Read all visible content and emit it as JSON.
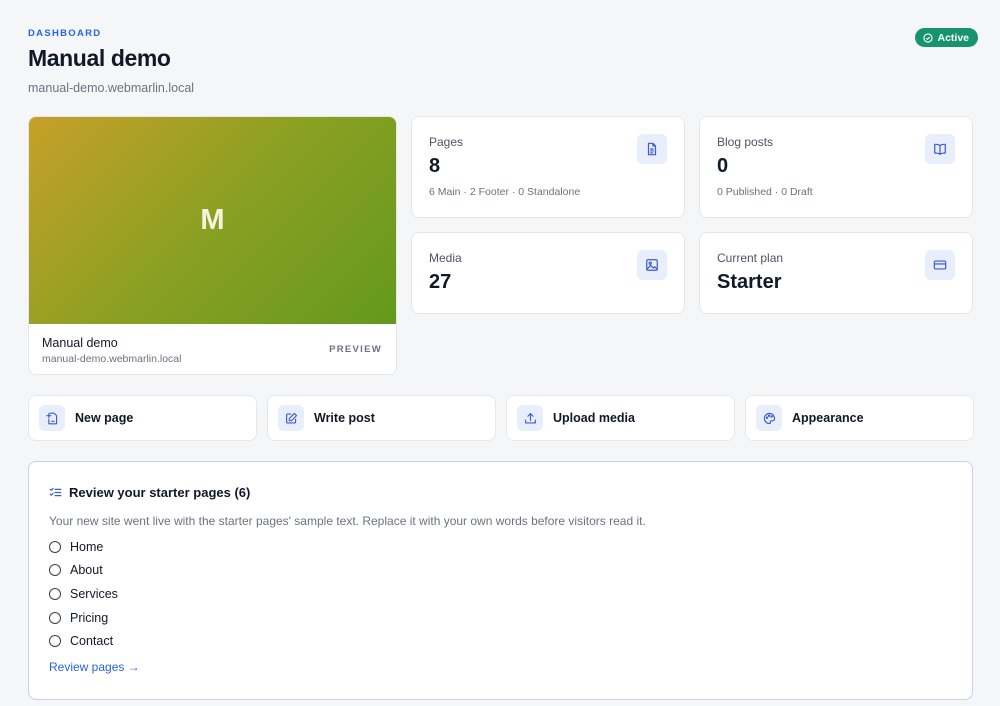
{
  "header": {
    "eyebrow": "DASHBOARD",
    "title": "Manual demo",
    "domain": "manual-demo.webmarlin.local",
    "status": "Active",
    "status_color": "#16946b"
  },
  "preview": {
    "initial": "M",
    "name": "Manual demo",
    "domain": "manual-demo.webmarlin.local",
    "link_label": "PREVIEW",
    "gradient_colors": [
      "#c7a029",
      "#63991d"
    ]
  },
  "stats": {
    "pages": {
      "label": "Pages",
      "value": "8",
      "sub": "6 Main · 2 Footer · 0 Standalone",
      "icon": "document-icon"
    },
    "blog": {
      "label": "Blog posts",
      "value": "0",
      "sub": "0 Published · 0 Draft",
      "icon": "book-icon"
    },
    "media": {
      "label": "Media",
      "value": "27",
      "icon": "image-icon"
    },
    "plan": {
      "label": "Current plan",
      "value": "Starter",
      "icon": "credit-card-icon"
    }
  },
  "actions": [
    {
      "label": "New page",
      "icon": "new-page-icon"
    },
    {
      "label": "Write post",
      "icon": "edit-icon"
    },
    {
      "label": "Upload media",
      "icon": "upload-icon"
    },
    {
      "label": "Appearance",
      "icon": "palette-icon"
    }
  ],
  "review": {
    "title": "Review your starter pages (6)",
    "description": "Your new site went live with the starter pages' sample text. Replace it with your own words before visitors read it.",
    "items": [
      "Home",
      "About",
      "Services",
      "Pricing",
      "Contact"
    ],
    "link": "Review pages →"
  },
  "colors": {
    "accent": "#2563eb",
    "icon_bg": "#e8eefb"
  }
}
